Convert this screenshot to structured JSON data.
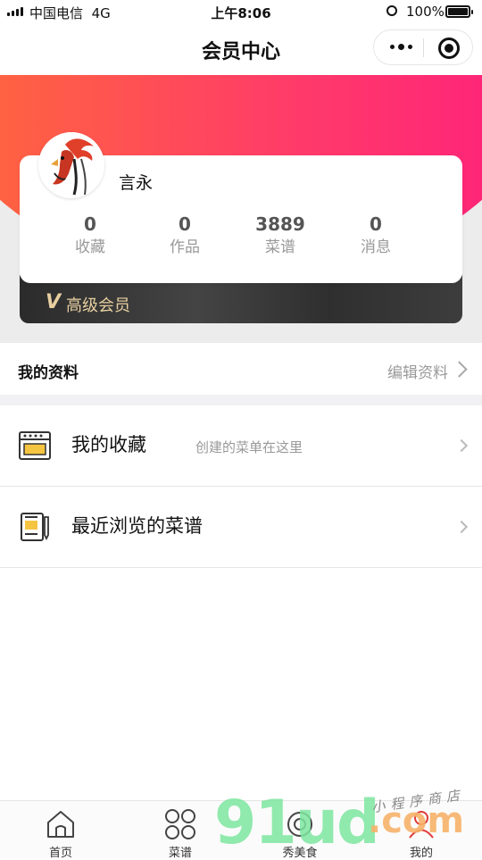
{
  "status_bar": {
    "carrier": "中国电信",
    "network": "4G",
    "time": "上午8:06",
    "battery": "100%"
  },
  "nav": {
    "title": "会员中心"
  },
  "profile": {
    "username": "言永",
    "stats": [
      {
        "value": "0",
        "label": "收藏"
      },
      {
        "value": "0",
        "label": "作品"
      },
      {
        "value": "3889",
        "label": "菜谱"
      },
      {
        "value": "0",
        "label": "消息"
      }
    ],
    "vip_label": "高级会员"
  },
  "my_profile": {
    "title": "我的资料",
    "edit_label": "编辑资料"
  },
  "menu": [
    {
      "label": "我的收藏",
      "subtitle": "创建的菜单在这里",
      "icon": "oven-icon"
    },
    {
      "label": "最近浏览的菜谱",
      "subtitle": "",
      "icon": "recipe-book-icon"
    }
  ],
  "tabs": [
    {
      "label": "首页",
      "icon": "home-icon"
    },
    {
      "label": "菜谱",
      "icon": "grid-circles-icon"
    },
    {
      "label": "秀美食",
      "icon": "camera-icon"
    },
    {
      "label": "我的",
      "icon": "person-icon"
    }
  ],
  "watermark": {
    "main": "91ud",
    "domain": ".com",
    "subtitle": "小程序商店"
  },
  "colors": {
    "gradient_start": "#ff6a3a",
    "gradient_end": "#ff1f7c",
    "vip_gold": "#e7cfa0",
    "vip_dark": "#2b2b2b"
  }
}
